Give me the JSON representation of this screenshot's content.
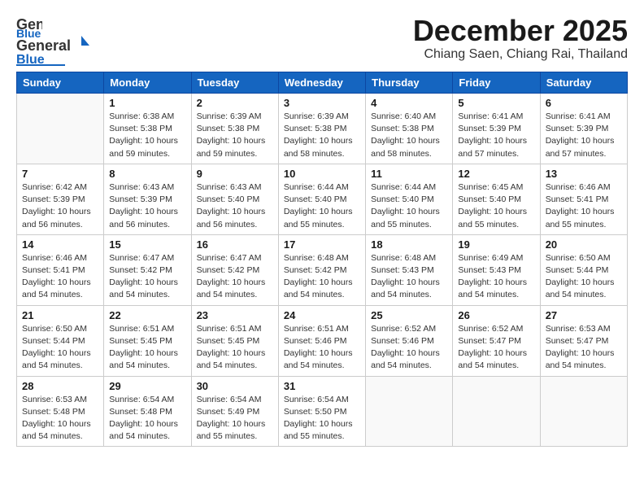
{
  "logo": {
    "general": "General",
    "blue": "Blue"
  },
  "title": "December 2025",
  "subtitle": "Chiang Saen, Chiang Rai, Thailand",
  "days_header": [
    "Sunday",
    "Monday",
    "Tuesday",
    "Wednesday",
    "Thursday",
    "Friday",
    "Saturday"
  ],
  "weeks": [
    [
      {
        "day": "",
        "info": ""
      },
      {
        "day": "1",
        "info": "Sunrise: 6:38 AM\nSunset: 5:38 PM\nDaylight: 10 hours\nand 59 minutes."
      },
      {
        "day": "2",
        "info": "Sunrise: 6:39 AM\nSunset: 5:38 PM\nDaylight: 10 hours\nand 59 minutes."
      },
      {
        "day": "3",
        "info": "Sunrise: 6:39 AM\nSunset: 5:38 PM\nDaylight: 10 hours\nand 58 minutes."
      },
      {
        "day": "4",
        "info": "Sunrise: 6:40 AM\nSunset: 5:38 PM\nDaylight: 10 hours\nand 58 minutes."
      },
      {
        "day": "5",
        "info": "Sunrise: 6:41 AM\nSunset: 5:39 PM\nDaylight: 10 hours\nand 57 minutes."
      },
      {
        "day": "6",
        "info": "Sunrise: 6:41 AM\nSunset: 5:39 PM\nDaylight: 10 hours\nand 57 minutes."
      }
    ],
    [
      {
        "day": "7",
        "info": "Sunrise: 6:42 AM\nSunset: 5:39 PM\nDaylight: 10 hours\nand 56 minutes."
      },
      {
        "day": "8",
        "info": "Sunrise: 6:43 AM\nSunset: 5:39 PM\nDaylight: 10 hours\nand 56 minutes."
      },
      {
        "day": "9",
        "info": "Sunrise: 6:43 AM\nSunset: 5:40 PM\nDaylight: 10 hours\nand 56 minutes."
      },
      {
        "day": "10",
        "info": "Sunrise: 6:44 AM\nSunset: 5:40 PM\nDaylight: 10 hours\nand 55 minutes."
      },
      {
        "day": "11",
        "info": "Sunrise: 6:44 AM\nSunset: 5:40 PM\nDaylight: 10 hours\nand 55 minutes."
      },
      {
        "day": "12",
        "info": "Sunrise: 6:45 AM\nSunset: 5:40 PM\nDaylight: 10 hours\nand 55 minutes."
      },
      {
        "day": "13",
        "info": "Sunrise: 6:46 AM\nSunset: 5:41 PM\nDaylight: 10 hours\nand 55 minutes."
      }
    ],
    [
      {
        "day": "14",
        "info": "Sunrise: 6:46 AM\nSunset: 5:41 PM\nDaylight: 10 hours\nand 54 minutes."
      },
      {
        "day": "15",
        "info": "Sunrise: 6:47 AM\nSunset: 5:42 PM\nDaylight: 10 hours\nand 54 minutes."
      },
      {
        "day": "16",
        "info": "Sunrise: 6:47 AM\nSunset: 5:42 PM\nDaylight: 10 hours\nand 54 minutes."
      },
      {
        "day": "17",
        "info": "Sunrise: 6:48 AM\nSunset: 5:42 PM\nDaylight: 10 hours\nand 54 minutes."
      },
      {
        "day": "18",
        "info": "Sunrise: 6:48 AM\nSunset: 5:43 PM\nDaylight: 10 hours\nand 54 minutes."
      },
      {
        "day": "19",
        "info": "Sunrise: 6:49 AM\nSunset: 5:43 PM\nDaylight: 10 hours\nand 54 minutes."
      },
      {
        "day": "20",
        "info": "Sunrise: 6:50 AM\nSunset: 5:44 PM\nDaylight: 10 hours\nand 54 minutes."
      }
    ],
    [
      {
        "day": "21",
        "info": "Sunrise: 6:50 AM\nSunset: 5:44 PM\nDaylight: 10 hours\nand 54 minutes."
      },
      {
        "day": "22",
        "info": "Sunrise: 6:51 AM\nSunset: 5:45 PM\nDaylight: 10 hours\nand 54 minutes."
      },
      {
        "day": "23",
        "info": "Sunrise: 6:51 AM\nSunset: 5:45 PM\nDaylight: 10 hours\nand 54 minutes."
      },
      {
        "day": "24",
        "info": "Sunrise: 6:51 AM\nSunset: 5:46 PM\nDaylight: 10 hours\nand 54 minutes."
      },
      {
        "day": "25",
        "info": "Sunrise: 6:52 AM\nSunset: 5:46 PM\nDaylight: 10 hours\nand 54 minutes."
      },
      {
        "day": "26",
        "info": "Sunrise: 6:52 AM\nSunset: 5:47 PM\nDaylight: 10 hours\nand 54 minutes."
      },
      {
        "day": "27",
        "info": "Sunrise: 6:53 AM\nSunset: 5:47 PM\nDaylight: 10 hours\nand 54 minutes."
      }
    ],
    [
      {
        "day": "28",
        "info": "Sunrise: 6:53 AM\nSunset: 5:48 PM\nDaylight: 10 hours\nand 54 minutes."
      },
      {
        "day": "29",
        "info": "Sunrise: 6:54 AM\nSunset: 5:48 PM\nDaylight: 10 hours\nand 54 minutes."
      },
      {
        "day": "30",
        "info": "Sunrise: 6:54 AM\nSunset: 5:49 PM\nDaylight: 10 hours\nand 55 minutes."
      },
      {
        "day": "31",
        "info": "Sunrise: 6:54 AM\nSunset: 5:50 PM\nDaylight: 10 hours\nand 55 minutes."
      },
      {
        "day": "",
        "info": ""
      },
      {
        "day": "",
        "info": ""
      },
      {
        "day": "",
        "info": ""
      }
    ]
  ]
}
